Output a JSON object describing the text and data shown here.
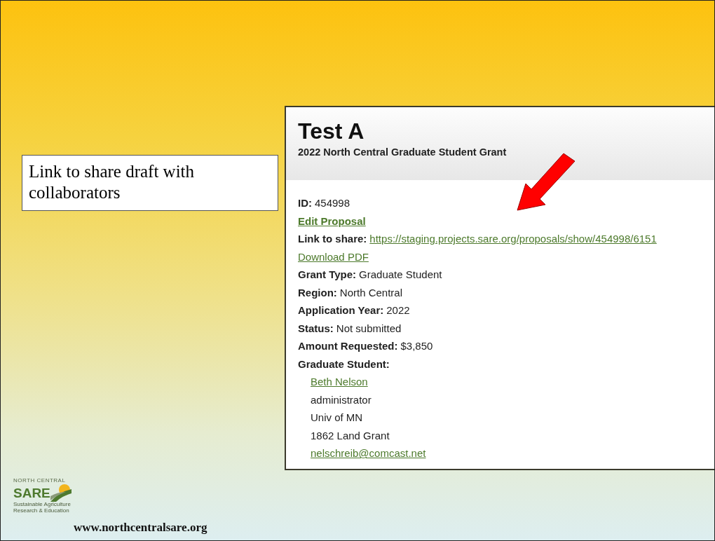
{
  "callout": {
    "text": "Link to share draft with collaborators"
  },
  "panel": {
    "title": "Test A",
    "subtitle": "2022 North Central Graduate Student Grant",
    "rows": [
      {
        "kind": "field",
        "label": "ID:",
        "value": "454998"
      },
      {
        "kind": "action",
        "text": "Edit Proposal"
      },
      {
        "kind": "field-link",
        "label": "Link to share:",
        "value": "https://staging.projects.sare.org/proposals/show/454998/6151"
      },
      {
        "kind": "link",
        "text": "Download PDF"
      },
      {
        "kind": "field",
        "label": "Grant Type:",
        "value": "Graduate Student"
      },
      {
        "kind": "field",
        "label": "Region:",
        "value": "North Central"
      },
      {
        "kind": "field",
        "label": "Application Year:",
        "value": "2022"
      },
      {
        "kind": "field",
        "label": "Status:",
        "value": "Not submitted"
      },
      {
        "kind": "field",
        "label": "Amount Requested:",
        "value": "$3,850"
      },
      {
        "kind": "heading",
        "text": "Graduate Student:"
      },
      {
        "kind": "sub-link",
        "text": "Beth Nelson"
      },
      {
        "kind": "sub",
        "text": "administrator"
      },
      {
        "kind": "sub",
        "text": "Univ of MN"
      },
      {
        "kind": "sub",
        "text": "1862 Land Grant"
      },
      {
        "kind": "sub-link",
        "text": "nelschreib@comcast.net"
      }
    ]
  },
  "footer": {
    "logo_top": "NORTH CENTRAL",
    "logo_name": "SARE",
    "logo_tagline": "Sustainable Agriculture Research & Education",
    "url": "www.northcentralsare.org"
  }
}
